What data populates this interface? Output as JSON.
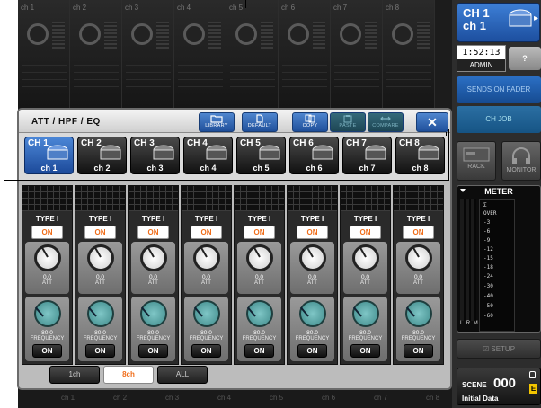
{
  "window": {
    "title": "ATT / HPF / EQ"
  },
  "toolbar": {
    "library_label": "LIBRARY",
    "default_label": "DEFAULT",
    "copy_label": "COPY",
    "paste_label": "PASTE",
    "compare_label": "COMPARE",
    "close_label": "✕"
  },
  "channels": [
    {
      "name": "CH 1",
      "label": "ch 1",
      "selected": true
    },
    {
      "name": "CH 2",
      "label": "ch 2",
      "selected": false
    },
    {
      "name": "CH 3",
      "label": "ch 3",
      "selected": false
    },
    {
      "name": "CH 4",
      "label": "ch 4",
      "selected": false
    },
    {
      "name": "CH 5",
      "label": "ch 5",
      "selected": false
    },
    {
      "name": "CH 6",
      "label": "ch 6",
      "selected": false
    },
    {
      "name": "CH 7",
      "label": "ch 7",
      "selected": false
    },
    {
      "name": "CH 8",
      "label": "ch 8",
      "selected": false
    }
  ],
  "strip": {
    "type_label": "TYPE I",
    "on_label": "ON",
    "att_value": "0.0",
    "att_label": "ATT",
    "freq_value": "80.0",
    "freq_label": "FREQUENCY",
    "hpf_on_label": "ON"
  },
  "tabs": [
    {
      "label": "1ch",
      "selected": false
    },
    {
      "label": "8ch",
      "selected": true
    },
    {
      "label": "ALL",
      "selected": false
    }
  ],
  "background": {
    "ch_labels": [
      "ch 1",
      "ch 2",
      "ch 3",
      "ch 4",
      "ch 5",
      "ch 6",
      "ch 7",
      "ch 8"
    ]
  },
  "sidebar": {
    "channel_name_line1": "CH 1",
    "channel_name_line2": "ch 1",
    "time": "1:52:13",
    "user": "ADMIN",
    "help_label": "?",
    "sends_on_fader": "SENDS ON FADER",
    "ch_job": "CH JOB",
    "rack_label": "RACK",
    "monitor_label": "MONITOR",
    "meter_title": "METER",
    "meter_scale": [
      "Σ",
      "OVER",
      "-3",
      "-6",
      "-9",
      "-12",
      "-15",
      "-18",
      "-24",
      "-30",
      "-40",
      "-50",
      "-60"
    ],
    "meter_lrm": "L R M",
    "setup_label": "SETUP",
    "scene_label": "SCENE",
    "scene_number": "000",
    "scene_title": "Initial Data",
    "scene_badge": "E"
  },
  "colors": {
    "accent_blue": "#2b6fc4",
    "on_orange": "#f06e1b",
    "scene_badge": "#f3c500"
  }
}
